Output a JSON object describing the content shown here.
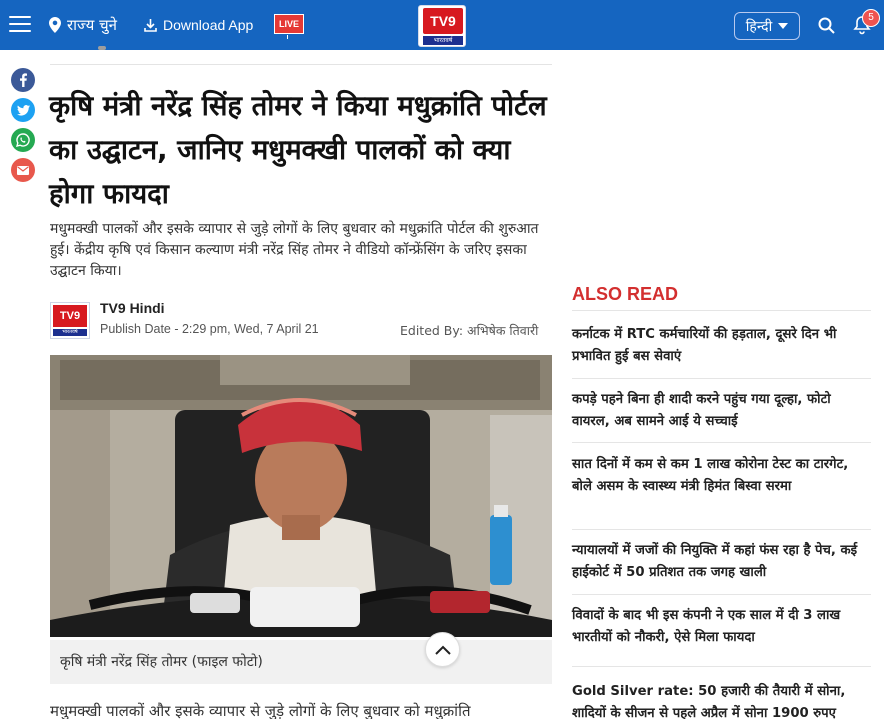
{
  "header": {
    "state_label": "राज्य चुने",
    "download_label": "Download App",
    "live_label": "LIVE",
    "logo_text": "TV9",
    "logo_sub": "भारतवर्ष",
    "language": "हिन्दी",
    "notification_count": "5"
  },
  "colors": {
    "header_bg": "#1565c0",
    "accent_red": "#d32f2f",
    "facebook": "#3b5998",
    "twitter": "#1da1f2",
    "whatsapp": "#25a952",
    "email": "#e8584c"
  },
  "share": [
    "facebook-icon",
    "twitter-icon",
    "whatsapp-icon",
    "email-icon"
  ],
  "article": {
    "headline": "कृषि मंत्री नरेंद्र सिंह तोमर ने किया मधुक्रांति पोर्टल का उद्घाटन, जानिए मधुमक्खी पालकों को क्या होगा फायदा",
    "summary": "मधुमक्खी पालकों और इसके व्यापार से जुड़े लोगों के लिए बुधवार को मधुक्रांति पोर्टल की शुरुआत हुई। केंद्रीय कृषि एवं किसान कल्याण मंत्री नरेंद्र सिंह तोमर ने वीडियो कॉन्फ्रेंसिंग के जरिए इसका उद्घाटन किया।",
    "author": "TV9 Hindi",
    "publish_date": "Publish Date - 2:29 pm, Wed, 7 April 21",
    "edited_by": "Edited By: अभिषेक तिवारी",
    "image_caption": "कृषि मंत्री नरेंद्र सिंह तोमर (फाइल फोटो)",
    "body_start": "मधुमक्खी पालकों और इसके व्यापार से जुड़े लोगों के लिए बुधवार को मधुक्रांति"
  },
  "also_read": {
    "title": "ALSO READ",
    "items": [
      "कर्नाटक में RTC कर्मचारियों की हड़ताल, दूसरे दिन भी प्रभावित हुई बस सेवाएं",
      "कपड़े पहने बिना ही शादी करने पहुंच गया दूल्हा, फोटो वायरल, अब सामने आई ये सच्चाई",
      "सात दिनों में कम से कम 1 लाख कोरोना टेस्ट का टारगेट, बोले असम के स्वास्थ्य मंत्री हिमंत बिस्वा सरमा",
      "न्यायालयों में जजों की नियुक्ति में कहां फंस रहा है पेच, कई हाईकोर्ट में 50 प्रतिशत तक जगह खाली",
      "विवादों के बाद भी इस कंपनी ने एक साल में दी 3 लाख भारतीयों को नौकरी, ऐसे मिला फायदा",
      "Gold Silver rate: 50 हजारी की तैयारी में सोना, शादियों के सीजन से पहले अप्रैल में सोना 1900 रुपए"
    ]
  }
}
